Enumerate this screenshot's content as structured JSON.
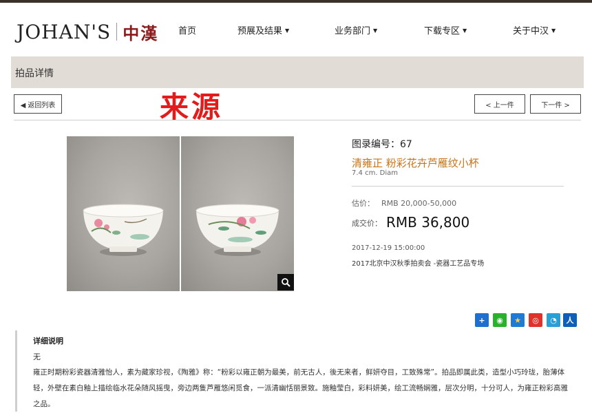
{
  "header": {
    "logo_en": "JOHAN'S",
    "logo_cn": "中漢",
    "nav": [
      {
        "label": "首页",
        "dropdown": false
      },
      {
        "label": "预展及结果",
        "dropdown": true
      },
      {
        "label": "业务部门",
        "dropdown": true
      },
      {
        "label": "下载专区",
        "dropdown": true
      },
      {
        "label": "关于中汉",
        "dropdown": true
      }
    ]
  },
  "breadcrumb": {
    "title": "拍品详情"
  },
  "toolbar": {
    "back_label": "◀ 返回列表",
    "prev_label": "< 上一件",
    "next_label": "下一件 >"
  },
  "overlay": {
    "source_text": "来源"
  },
  "lot": {
    "number_label": "图录编号：67",
    "title": "清雍正 粉彩花卉芦雁纹小杯",
    "dimensions": "7.4 cm. Diam",
    "estimate_label": "估价：",
    "estimate_value": "RMB 20,000-50,000",
    "sold_label": "成交价：",
    "sold_value": "RMB 36,800",
    "date": "2017-12-19 15:00:00",
    "session": "2017北京中汉秋季拍卖会 -瓷器工艺品专场"
  },
  "share_icons": [
    {
      "name": "add-share-icon",
      "glyph": "+",
      "color": "#1e6fd0"
    },
    {
      "name": "wechat-icon",
      "glyph": "◉",
      "color": "#29b12e"
    },
    {
      "name": "qzone-icon",
      "glyph": "★",
      "color": "#1f7ad6"
    },
    {
      "name": "weibo-icon",
      "glyph": "◎",
      "color": "#e0312b"
    },
    {
      "name": "tencent-weibo-icon",
      "glyph": "◔",
      "color": "#2a9fd6"
    },
    {
      "name": "renren-icon",
      "glyph": "人",
      "color": "#0f5eb7"
    }
  ],
  "detail": {
    "heading": "详细说明",
    "none_text": "无",
    "body": "雍正时期粉彩瓷器清雅怡人，素为藏家珍视，《陶雅》称：“粉彩以雍正朝为最美，前无古人，後无来者，鲜妍夺目，工致殊常”。拍品即属此类，造型小巧玲珑，胎薄体轻，外壁在素白釉上描绘临水花朵随风摇曳，旁边两隻芦雁悠闲觅食，一派清幽恬丽景致。施釉莹白，彩料妍美，绘工流畅娴雅，层次分明，十分可人，为雍正粉彩高雅之品。"
  }
}
